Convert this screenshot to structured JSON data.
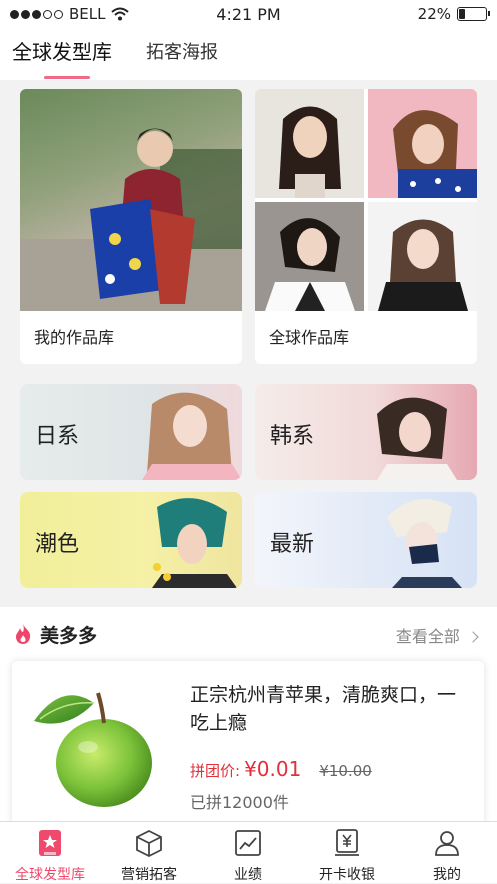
{
  "status": {
    "carrier": "BELL",
    "time": "4:21 PM",
    "battery": "22%"
  },
  "tabs": [
    {
      "label": "全球发型库"
    },
    {
      "label": "拓客海报"
    }
  ],
  "library": {
    "mine_label": "我的作品库",
    "global_label": "全球作品库"
  },
  "categories": [
    {
      "label": "日系"
    },
    {
      "label": "韩系"
    },
    {
      "label": "潮色"
    },
    {
      "label": "最新"
    }
  ],
  "section": {
    "title": "美多多",
    "view_all": "查看全部",
    "product": {
      "title": "正宗杭州青苹果，清脆爽口，一吃上瘾",
      "price_label": "拼团价:",
      "price": "¥0.01",
      "original_price": "¥10.00",
      "sold": "已拼12000件"
    }
  },
  "bottom_nav": [
    {
      "label": "全球发型库",
      "icon": "star-badge-icon",
      "active": true
    },
    {
      "label": "营销拓客",
      "icon": "box-icon",
      "active": false
    },
    {
      "label": "业绩",
      "icon": "chart-icon",
      "active": false
    },
    {
      "label": "开卡收银",
      "icon": "yen-icon",
      "active": false
    },
    {
      "label": "我的",
      "icon": "person-icon",
      "active": false
    }
  ],
  "colors": {
    "accent": "#ef4a6d",
    "price": "#e0303a"
  }
}
